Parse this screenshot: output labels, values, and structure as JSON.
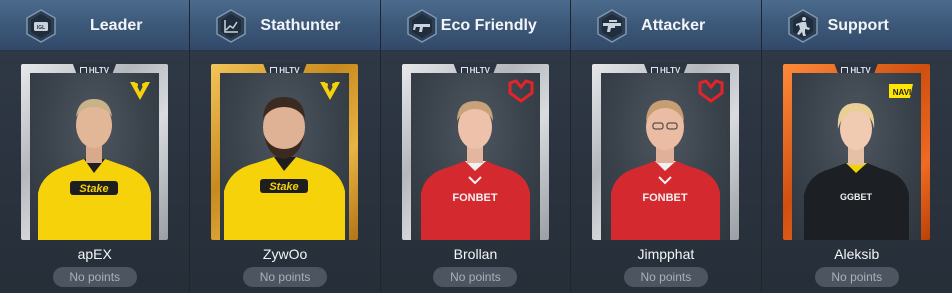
{
  "colors": {
    "header_top": "#4c6b8c",
    "panel_bg": "#2b3440",
    "badge_bg": "#4d5560",
    "vitality_yellow": "#f5d20a",
    "mouz_red": "#e2242b",
    "navi_yellow": "#ffe600"
  },
  "slots": [
    {
      "role": "Leader",
      "role_icon": "igl-badge-icon",
      "card_style": "silver",
      "card_brand": "HLTV",
      "team_logo": "vitality-bee-logo",
      "jersey": "yellow",
      "player_name": "apEX",
      "points_label": "No points"
    },
    {
      "role": "Stathunter",
      "role_icon": "line-chart-icon",
      "card_style": "gold",
      "card_brand": "HLTV",
      "team_logo": "vitality-bee-logo",
      "jersey": "yellow",
      "player_name": "ZywOo",
      "points_label": "No points"
    },
    {
      "role": "Eco Friendly",
      "role_icon": "smg-icon",
      "card_style": "silver",
      "card_brand": "HLTV",
      "team_logo": "mouz-logo",
      "jersey": "red",
      "player_name": "Brollan",
      "points_label": "No points"
    },
    {
      "role": "Attacker",
      "role_icon": "rifle-icon",
      "card_style": "silver",
      "card_brand": "HLTV",
      "team_logo": "mouz-logo",
      "jersey": "red",
      "player_name": "Jimpphat",
      "points_label": "No points"
    },
    {
      "role": "Support",
      "role_icon": "support-figure-icon",
      "card_style": "orange",
      "card_brand": "HLTV",
      "team_logo": "navi-logo",
      "jersey": "black",
      "player_name": "Aleksib",
      "points_label": "No points"
    }
  ]
}
